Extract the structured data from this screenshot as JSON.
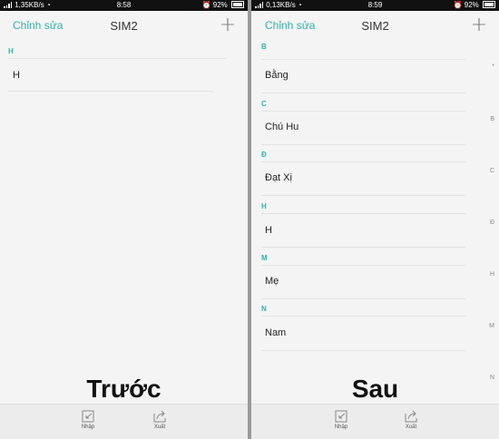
{
  "left": {
    "status": {
      "net": "1,35KB/s",
      "time": "8:58",
      "battery": "92%"
    },
    "edit_label": "Chỉnh sửa",
    "title": "SIM2",
    "add_symbol": "+",
    "sections": [
      {
        "letter": "H",
        "contacts": [
          "H"
        ]
      }
    ],
    "import_label": "Nhập",
    "export_label": "Xuất",
    "caption": "Trước"
  },
  "right": {
    "status": {
      "net": "0,13KB/s",
      "time": "8:59",
      "battery": "92%"
    },
    "edit_label": "Chỉnh sửa",
    "title": "SIM2",
    "add_symbol": "+",
    "sections": [
      {
        "letter": "B",
        "contacts": [
          "Bằng"
        ]
      },
      {
        "letter": "C",
        "contacts": [
          "Chú Hu"
        ]
      },
      {
        "letter": "Đ",
        "contacts": [
          "Đạt Xị"
        ]
      },
      {
        "letter": "H",
        "contacts": [
          "H"
        ]
      },
      {
        "letter": "M",
        "contacts": [
          "Mẹ"
        ]
      },
      {
        "letter": "N",
        "contacts": [
          "Nam"
        ]
      }
    ],
    "index": [
      "*",
      "B",
      "C",
      "Đ",
      "H",
      "M",
      "N"
    ],
    "import_label": "Nhập",
    "export_label": "Xuất",
    "caption": "Sau"
  },
  "colors": {
    "accent": "#2fb3a4",
    "divider": "#9a9a9a",
    "background": "#f4f4f4"
  }
}
